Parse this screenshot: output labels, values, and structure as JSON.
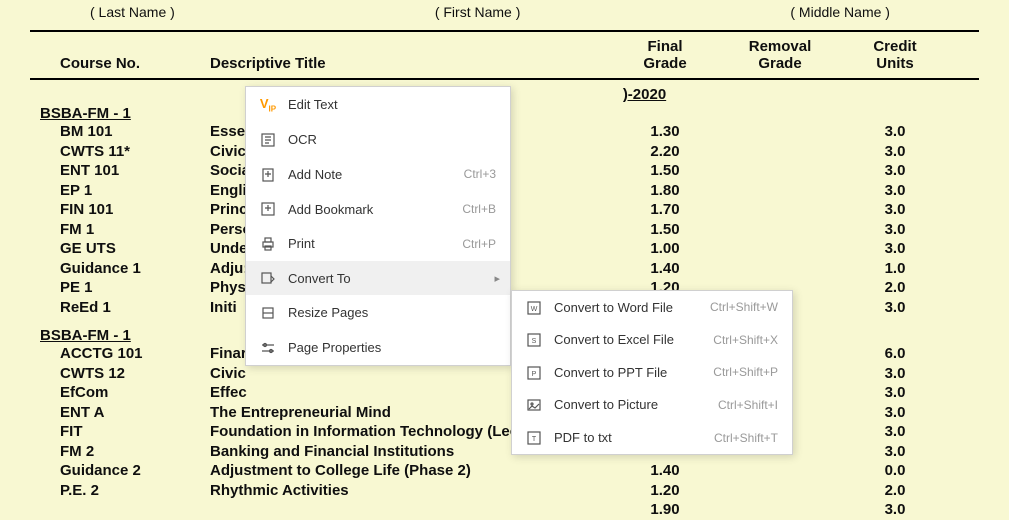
{
  "name_labels": {
    "last": "( Last Name )",
    "first": "( First Name )",
    "middle": "( Middle Name )"
  },
  "header": {
    "course": "Course No.",
    "title": "Descriptive Title",
    "final1": "Final",
    "final2": "Grade",
    "removal1": "Removal",
    "removal2": "Grade",
    "credit1": "Credit",
    "credit2": "Units"
  },
  "semester_partial": ")-2020",
  "program1": "BSBA-FM - 1",
  "program2": "BSBA-FM - 1",
  "rows1": [
    {
      "course": "BM 101",
      "title": "Essen",
      "final": "1.30",
      "credit": "3.0"
    },
    {
      "course": "CWTS 11*",
      "title": "Civic",
      "final": "2.20",
      "credit": "3.0"
    },
    {
      "course": "ENT 101",
      "title": "Socia",
      "final": "1.50",
      "credit": "3.0"
    },
    {
      "course": "EP 1",
      "title": "Engli",
      "final": "1.80",
      "credit": "3.0"
    },
    {
      "course": "FIN 101",
      "title": "Princ",
      "final": "1.70",
      "credit": "3.0"
    },
    {
      "course": "FM 1",
      "title": "Perso",
      "final": "1.50",
      "credit": "3.0"
    },
    {
      "course": "GE UTS",
      "title": "Unde",
      "final": "1.00",
      "credit": "3.0"
    },
    {
      "course": "Guidance 1",
      "title": "Adju:",
      "final": "1.40",
      "credit": "1.0"
    },
    {
      "course": "PE 1",
      "title": "Phys",
      "final": "1.20",
      "credit": "2.0"
    },
    {
      "course": "ReEd 1",
      "title": "Initi",
      "final": "",
      "credit": "3.0"
    }
  ],
  "rows2": [
    {
      "course": "ACCTG 101",
      "title": "Finar",
      "final": "",
      "credit": "6.0"
    },
    {
      "course": "CWTS 12",
      "title": "Civic",
      "final": "",
      "credit": "3.0"
    },
    {
      "course": "EfCom",
      "title": "Effec",
      "final": "",
      "credit": "3.0"
    },
    {
      "course": "ENT A",
      "title": "The Entrepreneurial Mind",
      "final": "",
      "credit": "3.0"
    },
    {
      "course": "FIT",
      "title": "Foundation in Information Technology (Lec/",
      "final": "",
      "credit": "3.0"
    },
    {
      "course": "FM 2",
      "title": "Banking and Financial Institutions",
      "final": "",
      "credit": "3.0"
    },
    {
      "course": "Guidance 2",
      "title": "Adjustment to College Life (Phase 2)",
      "final": "1.40",
      "credit": "0.0"
    },
    {
      "course": "P.E. 2",
      "title": "Rhythmic Activities",
      "final": "1.20",
      "credit": "2.0"
    },
    {
      "course": "",
      "title": "",
      "final": "1.90",
      "credit": "3.0"
    }
  ],
  "menu1": {
    "edit_text": "Edit Text",
    "ocr": "OCR",
    "add_note": "Add Note",
    "add_note_sc": "Ctrl+3",
    "add_bookmark": "Add Bookmark",
    "add_bookmark_sc": "Ctrl+B",
    "print": "Print",
    "print_sc": "Ctrl+P",
    "convert_to": "Convert To",
    "resize_pages": "Resize Pages",
    "page_properties": "Page Properties"
  },
  "menu2": {
    "word": "Convert to Word File",
    "word_sc": "Ctrl+Shift+W",
    "excel": "Convert to Excel File",
    "excel_sc": "Ctrl+Shift+X",
    "ppt": "Convert to PPT File",
    "ppt_sc": "Ctrl+Shift+P",
    "picture": "Convert to Picture",
    "picture_sc": "Ctrl+Shift+I",
    "txt": "PDF to txt",
    "txt_sc": "Ctrl+Shift+T"
  }
}
